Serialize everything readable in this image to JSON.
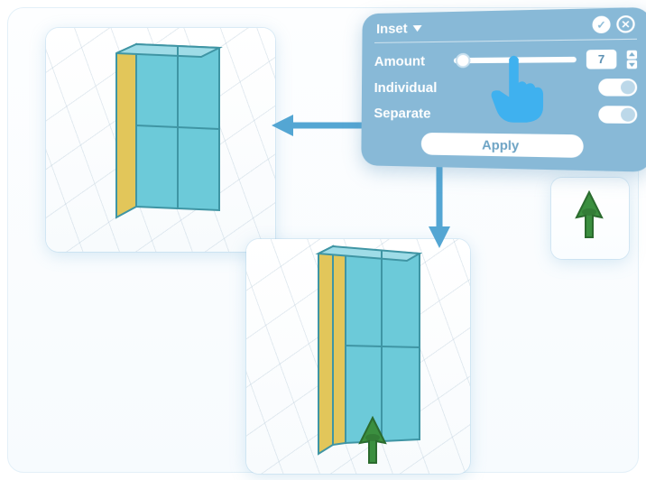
{
  "panel": {
    "title": "Inset",
    "confirm_icon": "check-icon",
    "cancel_icon": "close-icon",
    "amount": {
      "label": "Amount",
      "value": "7"
    },
    "individual": {
      "label": "Individual",
      "on": true
    },
    "separate": {
      "label": "Separate",
      "on": true
    },
    "apply_label": "Apply"
  },
  "thumbnails": {
    "top_left": "inset-result-merged",
    "bottom": "inset-result-separate",
    "nav": "navigation-cursor"
  },
  "colors": {
    "panel_bg": "#88b9d7",
    "accent": "#54a6d3",
    "mesh_face": "#6ccad9",
    "mesh_side": "#e2c65a",
    "cursor": "#3b8f3f"
  }
}
